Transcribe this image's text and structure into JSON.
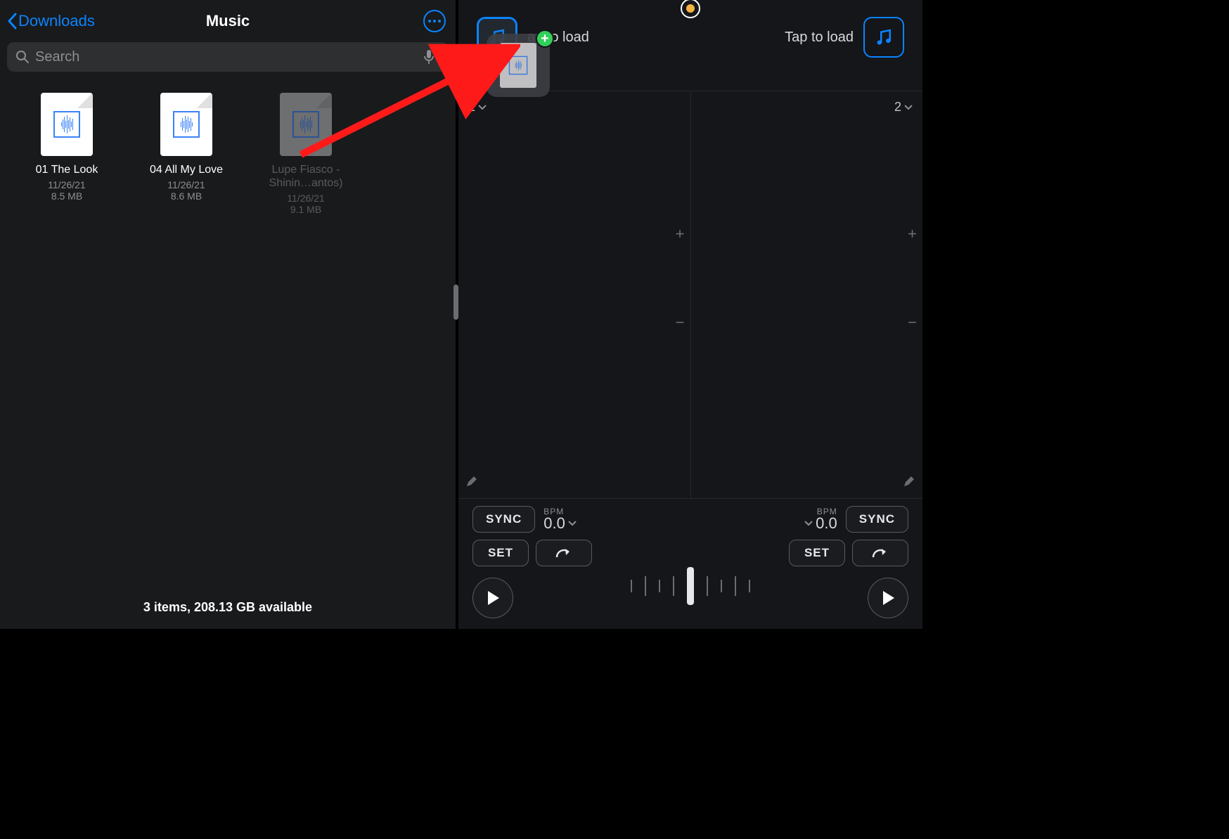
{
  "colors": {
    "accent": "#0a84ff",
    "success": "#30d158",
    "record": "#f5b342"
  },
  "files": {
    "back_label": "Downloads",
    "title": "Music",
    "search_placeholder": "Search",
    "items": [
      {
        "name": "01 The Look",
        "date": "11/26/21",
        "size": "8.5 MB",
        "dragged": false
      },
      {
        "name": "04 All My Love",
        "date": "11/26/21",
        "size": "8.6 MB",
        "dragged": false
      },
      {
        "name": "Lupe Fiasco - Shinin…antos)",
        "date": "11/26/21",
        "size": "9.1 MB",
        "dragged": true
      }
    ],
    "footer": "3 items, 208.13 GB available"
  },
  "dj": {
    "load_a_label": "ap to load",
    "load_b_label": "Tap to load",
    "deck_a_num": "1",
    "deck_b_num": "2",
    "sync_label": "SYNC",
    "set_label": "SET",
    "bpm_label": "BPM",
    "bpm_a": "0.0",
    "bpm_b": "0.0"
  },
  "drag": {
    "plus": "+"
  }
}
